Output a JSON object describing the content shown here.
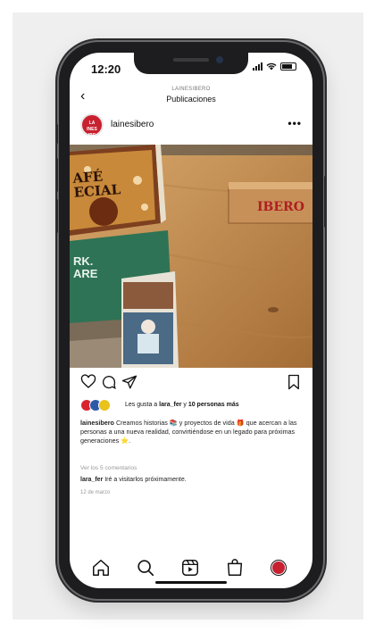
{
  "status_bar": {
    "time": "12:20"
  },
  "header": {
    "account": "LAINESIBERO",
    "title": "Publicaciones"
  },
  "post": {
    "username": "lainesibero",
    "avatar_text": "LA\nINES\nIBE",
    "photo_book_text_1": "AFÉ\nECIAL",
    "photo_book_text_2": "RK.\nARE",
    "photo_box_text": "IBERO",
    "likes_prefix": "Les gusta a ",
    "likes_user": "lara_fer",
    "likes_middle": " y ",
    "likes_count": "10 personas más",
    "caption_user": "lainesibero",
    "caption_text": " Creamos historias 📚 y proyectos de vida 🎁 que acercan a las personas a una nueva realidad, convirtiéndose en un legado para próximas generaciones ⭐.",
    "view_comments": "Ver los 5 comentarios",
    "comment_user": "lara_fer",
    "comment_text": " Iré a visitarlos próximamente.",
    "date": "12 de marzo"
  },
  "colors": {
    "brand_red": "#c8202f",
    "liker_1": "#d8232f",
    "liker_2": "#2d5aa8",
    "liker_3": "#e9c21c"
  },
  "tabbar": {
    "icons": [
      "home-icon",
      "search-icon",
      "reels-icon",
      "shop-icon",
      "profile-icon"
    ]
  }
}
